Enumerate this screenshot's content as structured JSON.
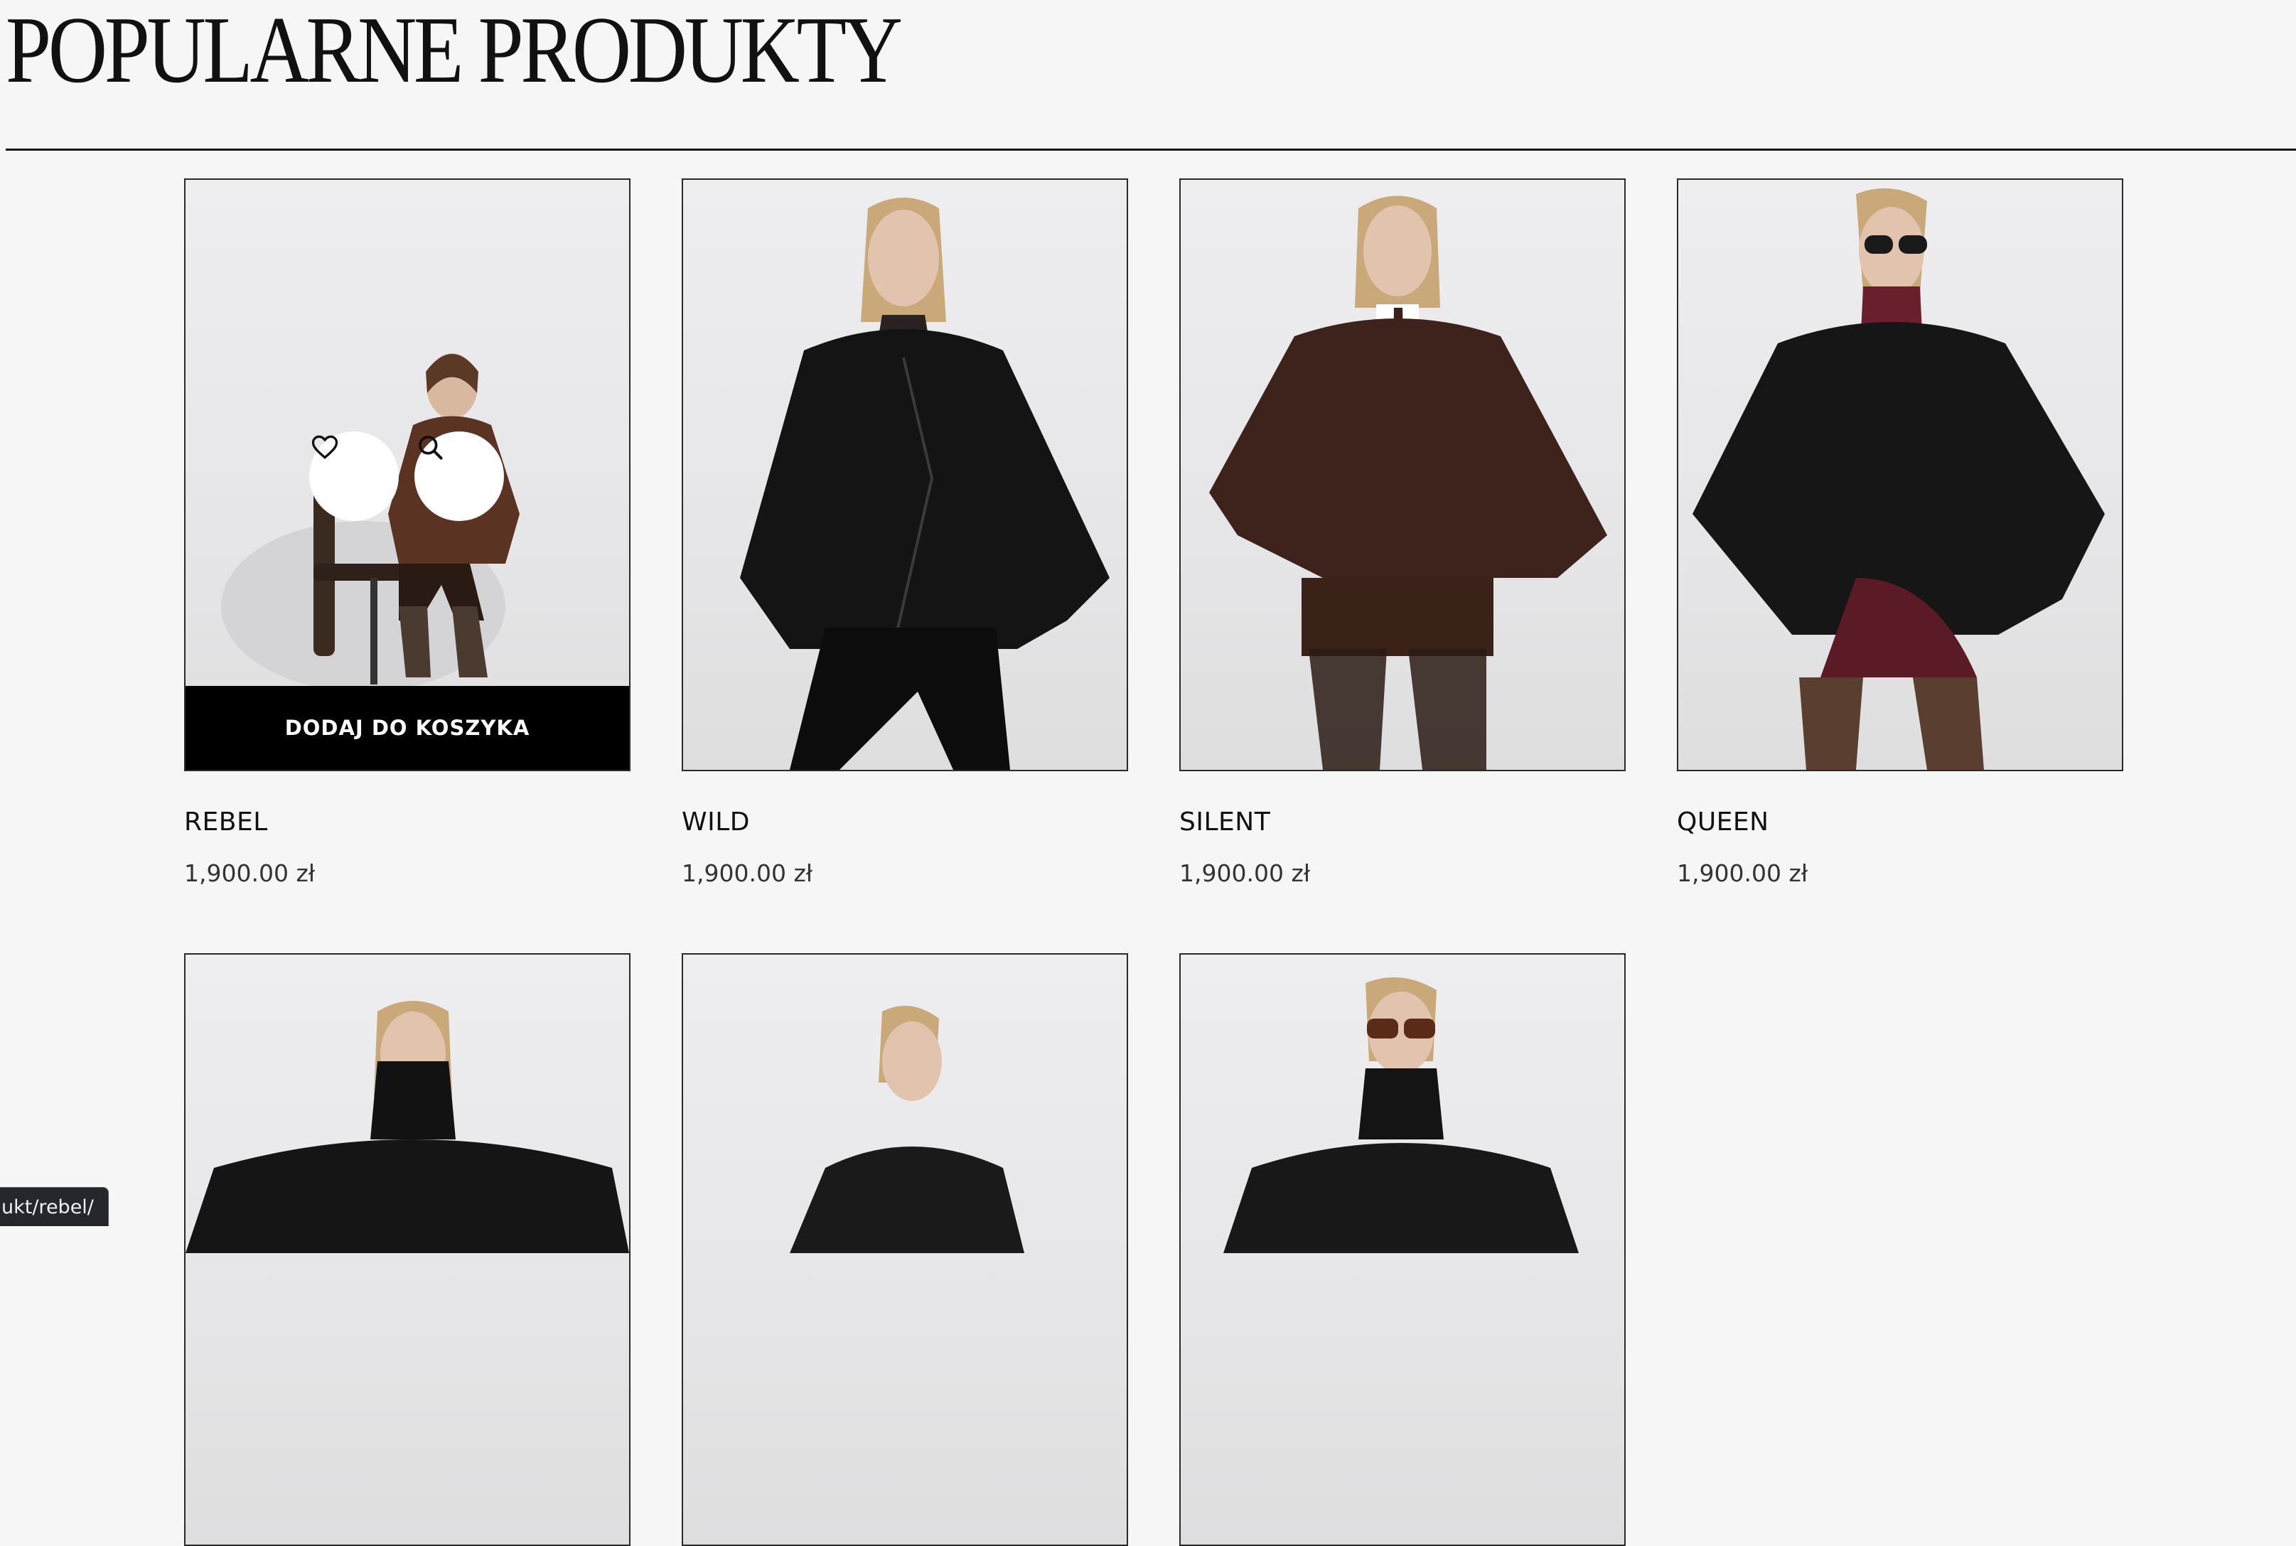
{
  "section": {
    "title": "POPULARNE PRODUKTY"
  },
  "products": [
    {
      "name": "REBEL",
      "price": "1,900.00 zł",
      "add_to_cart_label": "DODAJ DO KOSZYKA",
      "wishlist_icon": "heart-icon",
      "quickview_icon": "search-icon",
      "jacket_color": "#5a3322"
    },
    {
      "name": "WILD",
      "price": "1,900.00 zł",
      "jacket_color": "#141414"
    },
    {
      "name": "SILENT",
      "price": "1,900.00 zł",
      "jacket_color": "#3d231b"
    },
    {
      "name": "QUEEN",
      "price": "1,900.00 zł",
      "jacket_color": "#161616"
    },
    {
      "jacket_color": "#151515"
    },
    {
      "jacket_color": "#1a1a1a"
    },
    {
      "jacket_color": "#181818"
    }
  ],
  "status_bar": {
    "url": "ukt/rebel/"
  },
  "colors": {
    "background": "#f7f6f7",
    "text": "#111111",
    "button_bg": "#000000",
    "button_text": "#ffffff"
  }
}
